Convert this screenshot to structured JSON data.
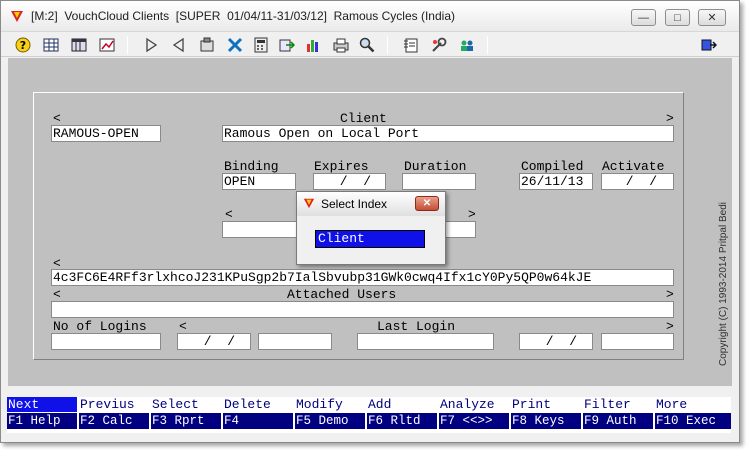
{
  "window": {
    "title": "[M:2]  VouchCloud Clients  [SUPER  01/04/11-31/03/12]  Ramous Cycles (India)",
    "minimize_glyph": "—",
    "maximize_glyph": "□",
    "close_glyph": "✕"
  },
  "toolbar": {
    "icons": [
      "help-icon",
      "grid-icon",
      "table-icon",
      "chart-icon",
      "next-arrow-icon",
      "prev-arrow-icon",
      "filter-icon",
      "tools-icon",
      "calculator-icon",
      "export-icon",
      "bar-chart-icon",
      "print-icon",
      "search-icon",
      "notes-icon",
      "settings-icon",
      "users-icon",
      "exit-icon"
    ]
  },
  "form": {
    "scroll_left_top": "<",
    "scroll_right_top": ">",
    "client_header": "Client",
    "client_code": "RAMOUS-OPEN",
    "client_name": "Ramous Open on Local Port",
    "binding_label": "Binding",
    "binding_value": "OPEN",
    "expires_label": "Expires",
    "expires_value": " /  /",
    "duration_label": "Duration",
    "duration_value": "",
    "compiled_label": "Compiled",
    "compiled_value": "26/11/13",
    "activate_label": "Activate",
    "activate_value": " /  /",
    "mid_left": "<",
    "mid_right": ">",
    "key_left": "<",
    "key_value": "4c3FC6E4RFf3rlxhcoJ231KPuSgp2b7IalSbvubp31GWk0cwq4Ifx1cY0Py5QP0w64kJE",
    "users_left": "<",
    "users_right": ">",
    "attached_users_label": "Attached Users",
    "logins_label": "No of Logins",
    "logins_left": "<",
    "last_login_label": "Last Login",
    "logins_right": ">",
    "date_a": " /  /",
    "date_b": " /  /"
  },
  "dialog": {
    "title": "Select Index",
    "close_glyph": "✕",
    "selected_item": "Client"
  },
  "fkeys": [
    {
      "top": "Next",
      "bottom": "F1 Help"
    },
    {
      "top": "Previus",
      "bottom": "F2 Calc"
    },
    {
      "top": "Select",
      "bottom": "F3 Rprt"
    },
    {
      "top": "Delete",
      "bottom": "F4"
    },
    {
      "top": "Modify",
      "bottom": "F5 Demo"
    },
    {
      "top": "Add",
      "bottom": "F6 Rltd"
    },
    {
      "top": "Analyze",
      "bottom": "F7 <<>>"
    },
    {
      "top": "Print",
      "bottom": "F8 Keys"
    },
    {
      "top": "Filter",
      "bottom": "F9 Auth"
    },
    {
      "top": "More",
      "bottom": "F10 Exec"
    }
  ],
  "copyright": "Copyright (C) 1993-2014  Pritpal Bedi",
  "colors": {
    "accent": "#000080",
    "highlight": "#1010e8",
    "workspace": "#c0c0c0"
  }
}
